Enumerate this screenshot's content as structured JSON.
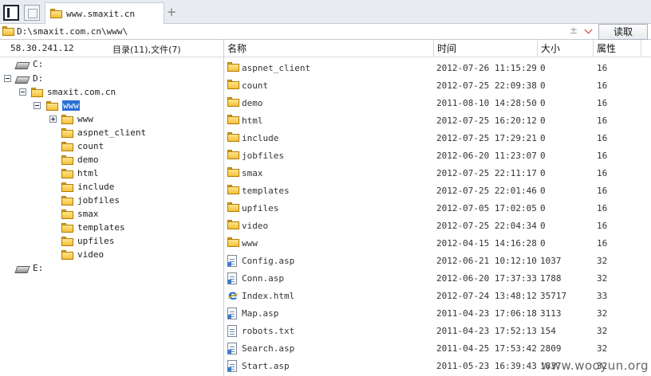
{
  "tab": {
    "title": "www.smaxit.cn",
    "icon": "folder-icon"
  },
  "address": {
    "path": "D:\\smaxit.com.cn\\www\\",
    "pm": "±",
    "go_label": "读取"
  },
  "left": {
    "ip": "58.30.241.12",
    "summary": "目录(11),文件(7)",
    "tree": [
      {
        "label": "C:",
        "icon": "drive-icon"
      },
      {
        "label": "D:",
        "icon": "drive-icon"
      },
      {
        "label": "smaxit.com.cn",
        "icon": "folder-icon"
      },
      {
        "label": "www",
        "icon": "folder-icon"
      },
      {
        "label": "www",
        "icon": "folder-icon"
      },
      {
        "label": "aspnet_client",
        "icon": "folder-icon"
      },
      {
        "label": "count",
        "icon": "folder-icon"
      },
      {
        "label": "demo",
        "icon": "folder-icon"
      },
      {
        "label": "html",
        "icon": "folder-icon"
      },
      {
        "label": "include",
        "icon": "folder-icon"
      },
      {
        "label": "jobfiles",
        "icon": "folder-icon"
      },
      {
        "label": "smax",
        "icon": "folder-icon"
      },
      {
        "label": "templates",
        "icon": "folder-icon"
      },
      {
        "label": "upfiles",
        "icon": "folder-icon"
      },
      {
        "label": "video",
        "icon": "folder-icon"
      },
      {
        "label": "E:",
        "icon": "drive-icon"
      }
    ]
  },
  "columns": {
    "name": "名称",
    "time": "时间",
    "size": "大小",
    "attr": "属性"
  },
  "rows": [
    {
      "name": "aspnet_client",
      "time": "2012-07-26 11:15:29",
      "size": "0",
      "attr": "16",
      "icon": "folder-icon"
    },
    {
      "name": "count",
      "time": "2012-07-25 22:09:38",
      "size": "0",
      "attr": "16",
      "icon": "folder-icon"
    },
    {
      "name": "demo",
      "time": "2011-08-10 14:28:50",
      "size": "0",
      "attr": "16",
      "icon": "folder-icon"
    },
    {
      "name": "html",
      "time": "2012-07-25 16:20:12",
      "size": "0",
      "attr": "16",
      "icon": "folder-icon"
    },
    {
      "name": "include",
      "time": "2012-07-25 17:29:21",
      "size": "0",
      "attr": "16",
      "icon": "folder-icon"
    },
    {
      "name": "jobfiles",
      "time": "2012-06-20 11:23:07",
      "size": "0",
      "attr": "16",
      "icon": "folder-icon"
    },
    {
      "name": "smax",
      "time": "2012-07-25 22:11:17",
      "size": "0",
      "attr": "16",
      "icon": "folder-icon"
    },
    {
      "name": "templates",
      "time": "2012-07-25 22:01:46",
      "size": "0",
      "attr": "16",
      "icon": "folder-icon"
    },
    {
      "name": "upfiles",
      "time": "2012-07-05 17:02:05",
      "size": "0",
      "attr": "16",
      "icon": "folder-icon"
    },
    {
      "name": "video",
      "time": "2012-07-25 22:04:34",
      "size": "0",
      "attr": "16",
      "icon": "folder-icon"
    },
    {
      "name": "www",
      "time": "2012-04-15 14:16:28",
      "size": "0",
      "attr": "16",
      "icon": "folder-icon"
    },
    {
      "name": "Config.asp",
      "time": "2012-06-21 10:12:10",
      "size": "1037",
      "attr": "32",
      "icon": "asp-file-icon"
    },
    {
      "name": "Conn.asp",
      "time": "2012-06-20 17:37:33",
      "size": "1788",
      "attr": "32",
      "icon": "asp-file-icon"
    },
    {
      "name": "Index.html",
      "time": "2012-07-24 13:48:12",
      "size": "35717",
      "attr": "33",
      "icon": "ie-html-icon"
    },
    {
      "name": "Map.asp",
      "time": "2011-04-23 17:06:18",
      "size": "3113",
      "attr": "32",
      "icon": "asp-file-icon"
    },
    {
      "name": "robots.txt",
      "time": "2011-04-23 17:52:13",
      "size": "154",
      "attr": "32",
      "icon": "text-file-icon"
    },
    {
      "name": "Search.asp",
      "time": "2011-04-25 17:53:42",
      "size": "2809",
      "attr": "32",
      "icon": "asp-file-icon"
    },
    {
      "name": "Start.asp",
      "time": "2011-05-23 16:39:43",
      "size": "1837",
      "attr": "32",
      "icon": "asp-file-icon"
    }
  ],
  "watermark": "www.wooyun.org"
}
